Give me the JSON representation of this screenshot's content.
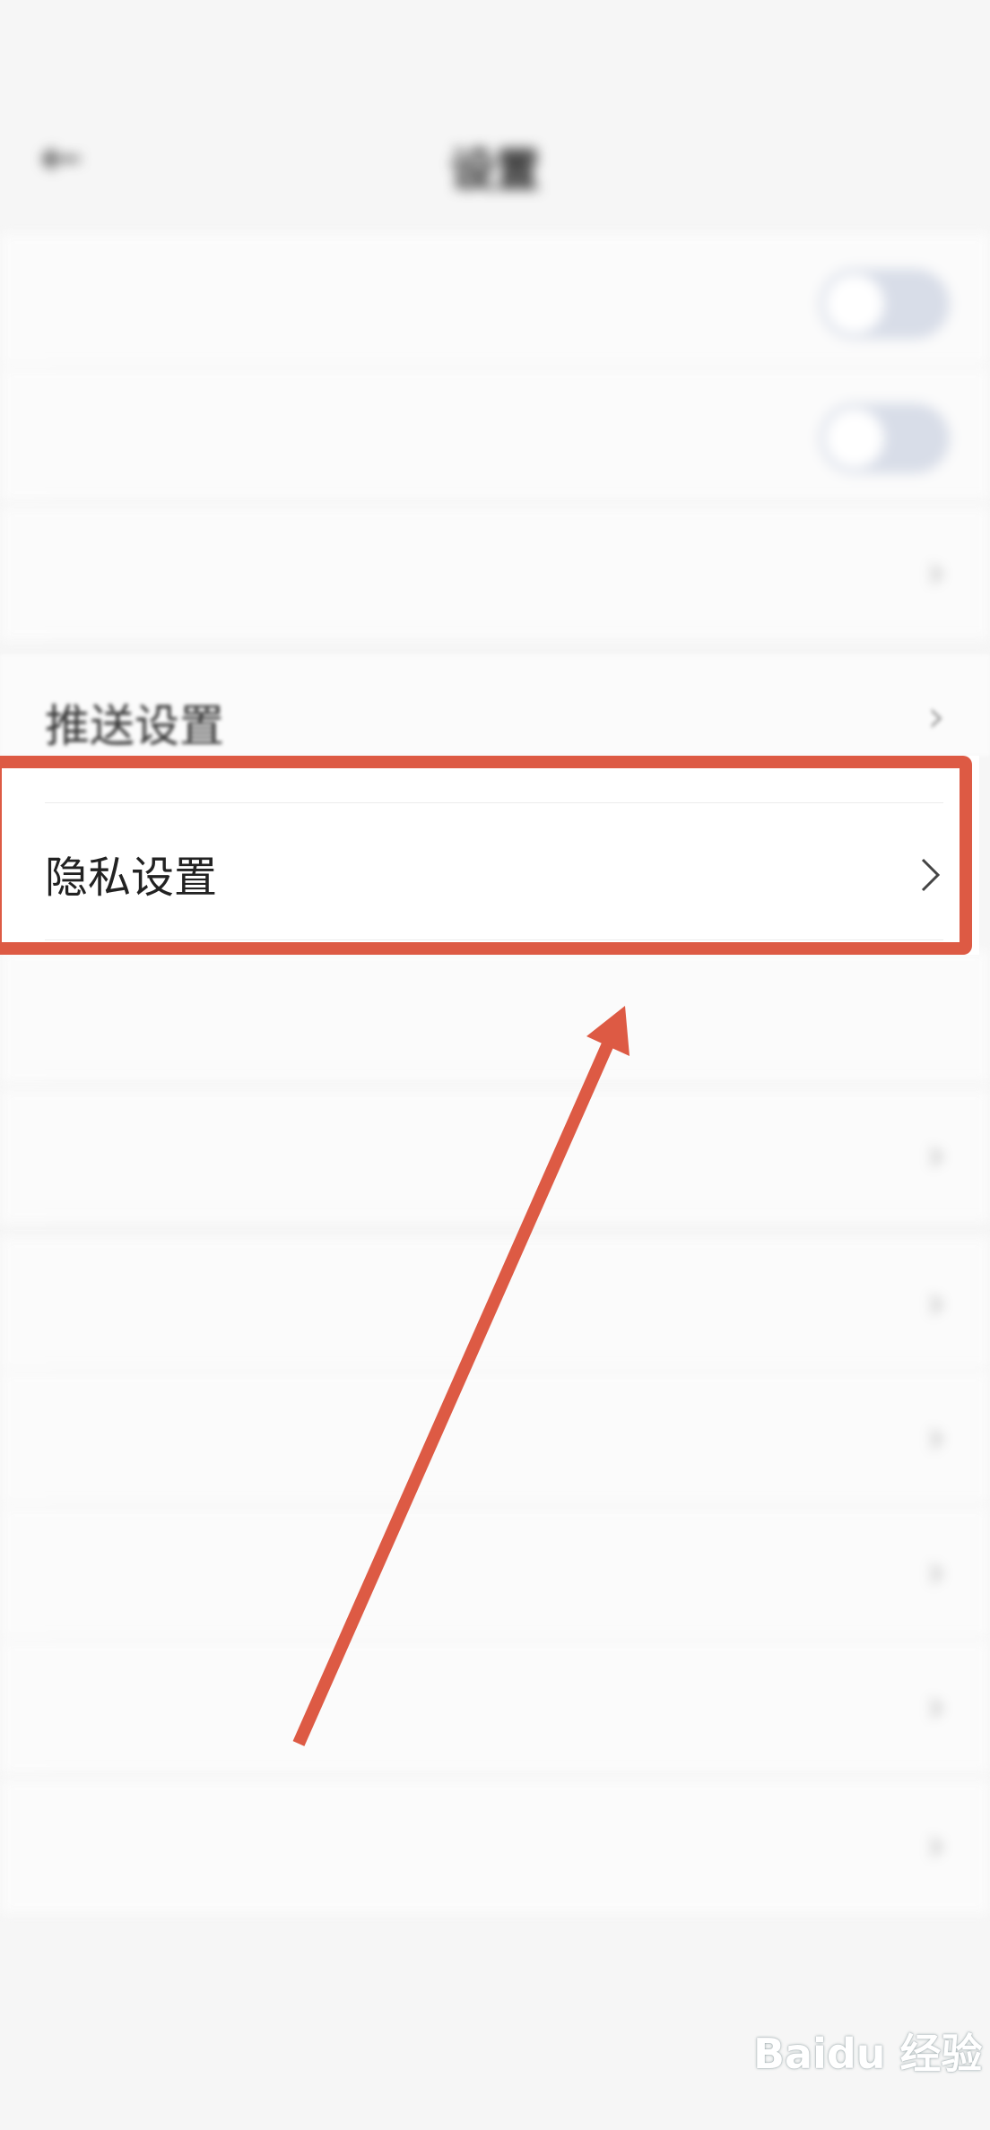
{
  "status_bar": {
    "time": "",
    "center_text": "",
    "right_text": ""
  },
  "nav": {
    "title": "设置"
  },
  "rows": [
    {
      "label": "",
      "type": "toggle"
    },
    {
      "label": "",
      "type": "toggle"
    },
    {
      "label": "",
      "type": "chevron"
    },
    {
      "label": "推送设置",
      "type": "chevron"
    },
    {
      "label": "隐私设置",
      "type": "chevron",
      "highlighted": true
    },
    {
      "label": "",
      "type": "none"
    },
    {
      "label": "",
      "type": "chevron"
    },
    {
      "label": "",
      "type": "chevron"
    },
    {
      "label": "",
      "type": "chevron"
    },
    {
      "label": "",
      "type": "chevron"
    },
    {
      "label": "",
      "type": "chevron"
    },
    {
      "label": "",
      "type": "chevron"
    }
  ],
  "logout": {
    "label": ""
  },
  "annotation": {
    "box_color": "#dd5a44",
    "arrow_color": "#dd5a44"
  },
  "watermark": {
    "text": "Baidu 经验"
  },
  "icons": {
    "back": "back-arrow-icon",
    "chevron": "chevron-right-icon"
  }
}
